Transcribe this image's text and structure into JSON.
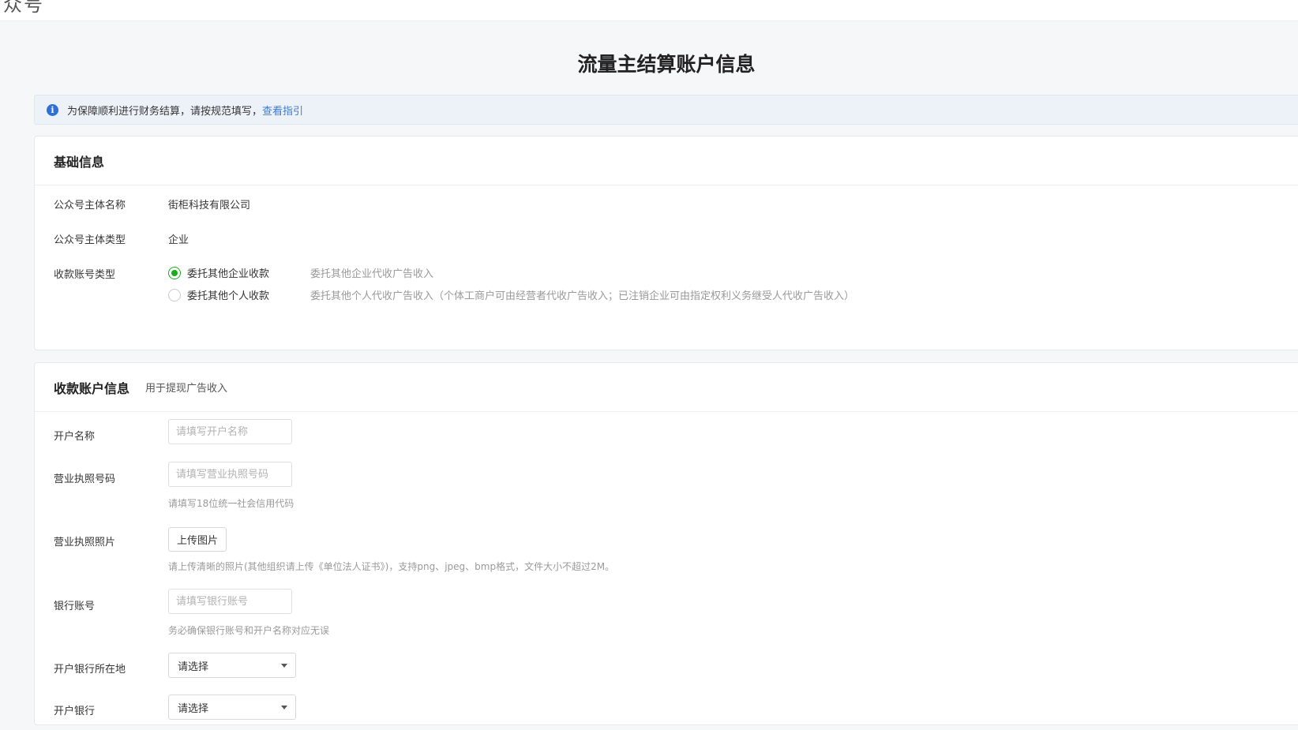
{
  "topbar": {
    "title": "众号"
  },
  "page": {
    "title": "流量主结算账户信息"
  },
  "notice": {
    "icon": "info-icon",
    "text": "为保障顺利进行财务结算，请按规范填写，",
    "link": "查看指引"
  },
  "basic": {
    "title": "基础信息",
    "fields": {
      "entity_name_label": "公众号主体名称",
      "entity_name_value": "街柜科技有限公司",
      "entity_type_label": "公众号主体类型",
      "entity_type_value": "企业",
      "account_type_label": "收款账号类型"
    },
    "options": [
      {
        "label": "委托其他企业收款",
        "desc": "委托其他企业代收广告收入",
        "checked": true
      },
      {
        "label": "委托其他个人收款",
        "desc": "委托其他个人代收广告收入（个体工商户可由经营者代收广告收入；已注销企业可由指定权利义务继受人代收广告收入）",
        "checked": false
      }
    ]
  },
  "account": {
    "title": "收款账户信息",
    "subtitle": "用于提现广告收入",
    "account_name": {
      "label": "开户名称",
      "placeholder": "请填写开户名称"
    },
    "license_no": {
      "label": "营业执照号码",
      "placeholder": "请填写营业执照号码",
      "hint": "请填写18位统一社会信用代码"
    },
    "license_photo": {
      "label": "营业执照照片",
      "button": "上传图片",
      "hint": "请上传清晰的照片(其他组织请上传《单位法人证书》)，支持png、jpeg、bmp格式，文件大小不超过2M。"
    },
    "bank_account": {
      "label": "银行账号",
      "placeholder": "请填写银行账号",
      "hint": "务必确保银行账号和开户名称对应无误"
    },
    "bank_location": {
      "label": "开户银行所在地",
      "selected": "请选择"
    },
    "bank": {
      "label": "开户银行",
      "selected": "请选择"
    }
  }
}
